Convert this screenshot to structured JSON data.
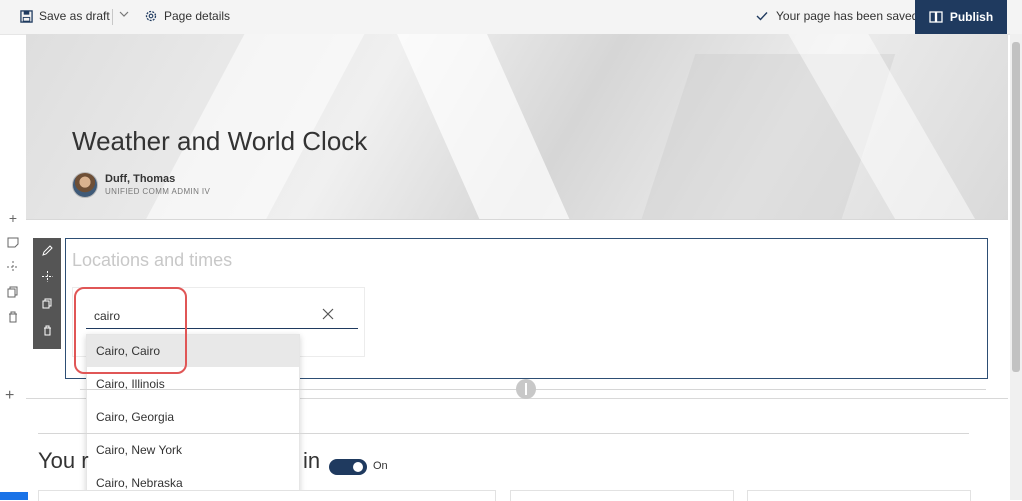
{
  "toolbar": {
    "save_draft_label": "Save as draft",
    "page_details_label": "Page details",
    "saved_status": "Your page has been saved",
    "publish_label": "Publish"
  },
  "header": {
    "title": "Weather and World Clock",
    "author_name": "Duff, Thomas",
    "author_title": "UNIFIED COMM ADMIN IV"
  },
  "webpart": {
    "title": "Locations and times",
    "search": {
      "value": "cairo"
    },
    "suggestions": [
      "Cairo, Cairo",
      "Cairo, Illinois",
      "Cairo, Georgia",
      "Cairo, New York",
      "Cairo, Nebraska"
    ],
    "selected_index": 0
  },
  "lower_section": {
    "heading_start": "You r",
    "heading_end": "in",
    "toggle_label": "On",
    "toggle_on": true
  },
  "colors": {
    "accent": "#1f3a5f",
    "highlight": "#e05656"
  }
}
